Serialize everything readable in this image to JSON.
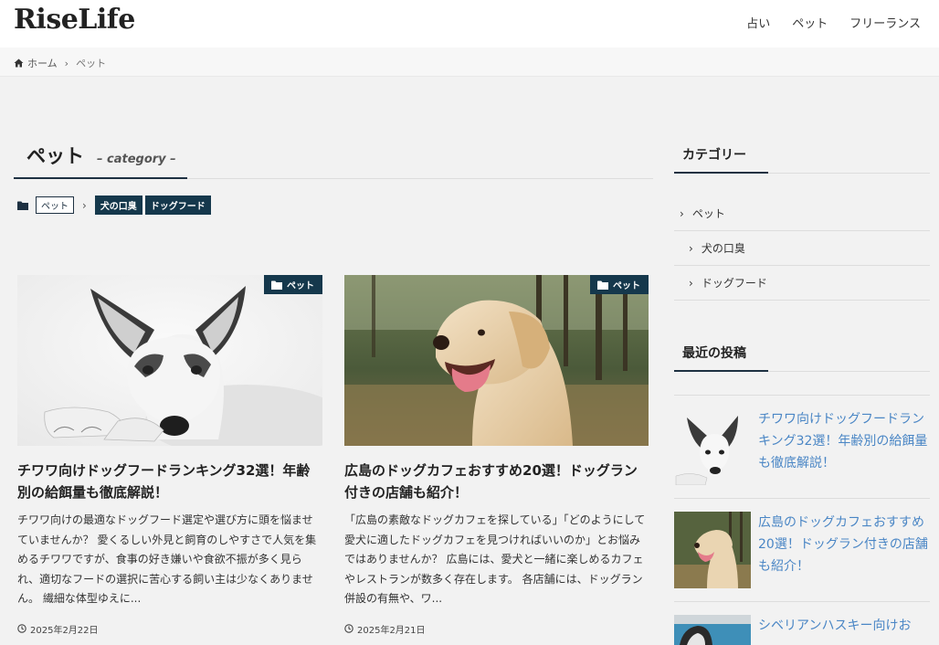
{
  "site": {
    "logo": "RiseLife"
  },
  "nav": [
    "占い",
    "ペット",
    "フリーランス"
  ],
  "breadcrumb": {
    "home": "ホーム",
    "current": "ペット"
  },
  "category": {
    "title": "ペット",
    "subtitle": "– category –"
  },
  "tags": {
    "parent": "ペット",
    "children": [
      "犬の口臭",
      "ドッグフード"
    ]
  },
  "posts": [
    {
      "badge": "ペット",
      "title": "チワワ向けドッグフードランキング32選！年齢別の給餌量も徹底解説！",
      "excerpt": "チワワ向けの最適なドッグフード選定や選び方に頭を悩ませていませんか？ 愛くるしい外見と飼育のしやすさで人気を集めるチワワですが、食事の好き嫌いや食欲不振が多く見られ、適切なフードの選択に苦心する飼い主は少なくありません。 繊細な体型ゆえに...",
      "date": "2025年2月22日"
    },
    {
      "badge": "ペット",
      "title": "広島のドッグカフェおすすめ20選！ドッグラン付きの店舗も紹介！",
      "excerpt": "「広島の素敵なドッグカフェを探している」「どのようにして愛犬に適したドッグカフェを見つければいいのか」とお悩みではありませんか？ 広島には、愛犬と一緒に楽しめるカフェやレストランが数多く存在します。 各店舗には、ドッグラン併設の有無や、ワ...",
      "date": "2025年2月21日"
    }
  ],
  "sidebar": {
    "categories_title": "カテゴリー",
    "categories": [
      "ペット",
      "犬の口臭",
      "ドッグフード"
    ],
    "recent_title": "最近の投稿",
    "recent": [
      "チワワ向けドッグフードランキング32選！年齢別の給餌量も徹底解説！",
      "広島のドッグカフェおすすめ20選！ドッグラン付きの店舗も紹介！",
      "シベリアンハスキー向けお"
    ]
  },
  "colors": {
    "accent": "#15384c",
    "link": "#4a86c5",
    "background": "#f2f2f2"
  },
  "icons": [
    "home-icon",
    "folder-icon",
    "clock-icon",
    "chevron-right-icon"
  ]
}
